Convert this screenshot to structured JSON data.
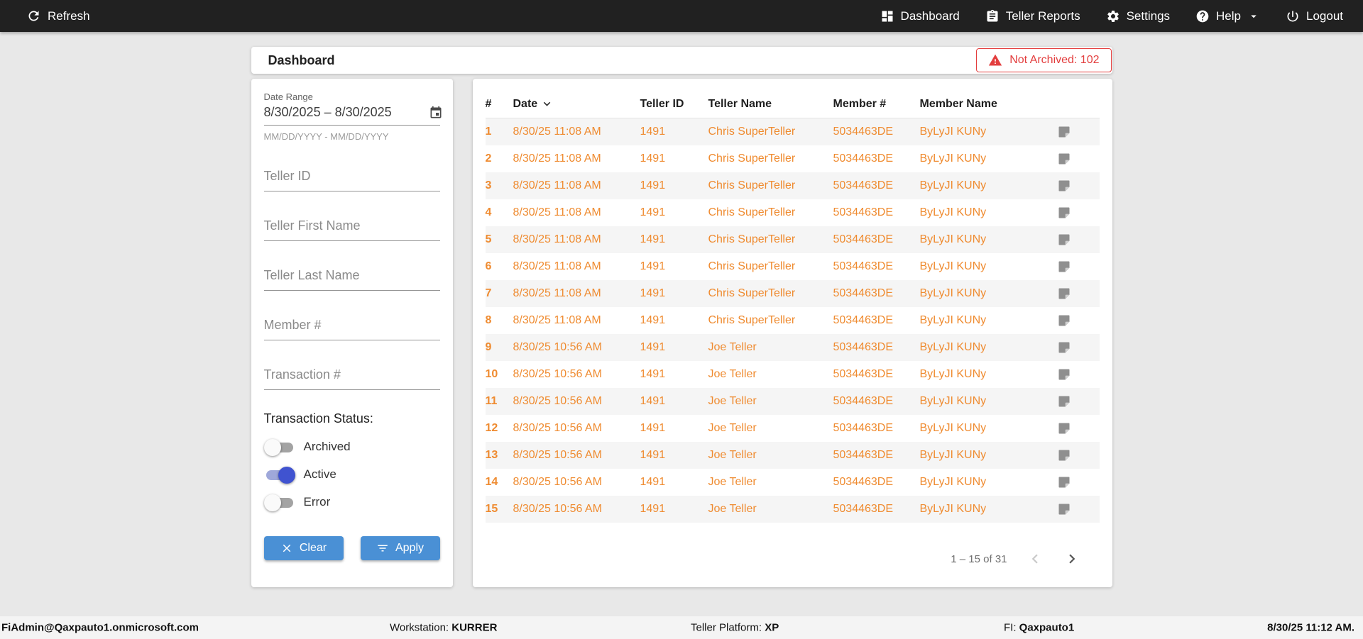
{
  "colors": {
    "orange": "#ef8b30",
    "blue": "#4a90d5",
    "red": "#e33e3e",
    "toggle_on": "#4053d0",
    "topbar": "#212121"
  },
  "topbar": {
    "refresh_label": "Refresh",
    "nav": [
      {
        "label": "Dashboard"
      },
      {
        "label": "Teller Reports"
      },
      {
        "label": "Settings"
      },
      {
        "label": "Help"
      },
      {
        "label": "Logout"
      }
    ]
  },
  "header": {
    "title": "Dashboard",
    "badge_label": "Not Archived: 102"
  },
  "filters": {
    "date_range_label": "Date Range",
    "date_range_value": "8/30/2025 – 8/30/2025",
    "date_range_hint": "MM/DD/YYYY - MM/DD/YYYY",
    "fields": [
      "Teller ID",
      "Teller First Name",
      "Teller Last Name",
      "Member #",
      "Transaction #"
    ],
    "status_label": "Transaction Status:",
    "toggles": [
      {
        "label": "Archived",
        "on": false
      },
      {
        "label": "Active",
        "on": true
      },
      {
        "label": "Error",
        "on": false
      }
    ],
    "clear_label": "Clear",
    "apply_label": "Apply"
  },
  "table": {
    "columns": [
      "#",
      "Date",
      "Teller ID",
      "Teller Name",
      "Member #",
      "Member Name"
    ],
    "rows": [
      {
        "num": "1",
        "date": "8/30/25 11:08 AM",
        "teller_id": "1491",
        "teller_name": "Chris SuperTeller",
        "member_num": "5034463DE",
        "member_name": "ByLyJI KUNy"
      },
      {
        "num": "2",
        "date": "8/30/25 11:08 AM",
        "teller_id": "1491",
        "teller_name": "Chris SuperTeller",
        "member_num": "5034463DE",
        "member_name": "ByLyJI KUNy"
      },
      {
        "num": "3",
        "date": "8/30/25 11:08 AM",
        "teller_id": "1491",
        "teller_name": "Chris SuperTeller",
        "member_num": "5034463DE",
        "member_name": "ByLyJI KUNy"
      },
      {
        "num": "4",
        "date": "8/30/25 11:08 AM",
        "teller_id": "1491",
        "teller_name": "Chris SuperTeller",
        "member_num": "5034463DE",
        "member_name": "ByLyJI KUNy"
      },
      {
        "num": "5",
        "date": "8/30/25 11:08 AM",
        "teller_id": "1491",
        "teller_name": "Chris SuperTeller",
        "member_num": "5034463DE",
        "member_name": "ByLyJI KUNy"
      },
      {
        "num": "6",
        "date": "8/30/25 11:08 AM",
        "teller_id": "1491",
        "teller_name": "Chris SuperTeller",
        "member_num": "5034463DE",
        "member_name": "ByLyJI KUNy"
      },
      {
        "num": "7",
        "date": "8/30/25 11:08 AM",
        "teller_id": "1491",
        "teller_name": "Chris SuperTeller",
        "member_num": "5034463DE",
        "member_name": "ByLyJI KUNy"
      },
      {
        "num": "8",
        "date": "8/30/25 11:08 AM",
        "teller_id": "1491",
        "teller_name": "Chris SuperTeller",
        "member_num": "5034463DE",
        "member_name": "ByLyJI KUNy"
      },
      {
        "num": "9",
        "date": "8/30/25 10:56 AM",
        "teller_id": "1491",
        "teller_name": "Joe Teller",
        "member_num": "5034463DE",
        "member_name": "ByLyJI KUNy"
      },
      {
        "num": "10",
        "date": "8/30/25 10:56 AM",
        "teller_id": "1491",
        "teller_name": "Joe Teller",
        "member_num": "5034463DE",
        "member_name": "ByLyJI KUNy"
      },
      {
        "num": "11",
        "date": "8/30/25 10:56 AM",
        "teller_id": "1491",
        "teller_name": "Joe Teller",
        "member_num": "5034463DE",
        "member_name": "ByLyJI KUNy"
      },
      {
        "num": "12",
        "date": "8/30/25 10:56 AM",
        "teller_id": "1491",
        "teller_name": "Joe Teller",
        "member_num": "5034463DE",
        "member_name": "ByLyJI KUNy"
      },
      {
        "num": "13",
        "date": "8/30/25 10:56 AM",
        "teller_id": "1491",
        "teller_name": "Joe Teller",
        "member_num": "5034463DE",
        "member_name": "ByLyJI KUNy"
      },
      {
        "num": "14",
        "date": "8/30/25 10:56 AM",
        "teller_id": "1491",
        "teller_name": "Joe Teller",
        "member_num": "5034463DE",
        "member_name": "ByLyJI KUNy"
      },
      {
        "num": "15",
        "date": "8/30/25 10:56 AM",
        "teller_id": "1491",
        "teller_name": "Joe Teller",
        "member_num": "5034463DE",
        "member_name": "ByLyJI KUNy"
      }
    ],
    "pagination_range": "1 – 15 of 31"
  },
  "statusbar": {
    "user": "FiAdmin@Qaxpauto1.onmicrosoft.com",
    "workstation_label": "Workstation:",
    "workstation_value": "KURRER",
    "platform_label": "Teller Platform:",
    "platform_value": "XP",
    "fi_label": "FI:",
    "fi_value": "Qaxpauto1",
    "timestamp": "8/30/25 11:12 AM."
  }
}
